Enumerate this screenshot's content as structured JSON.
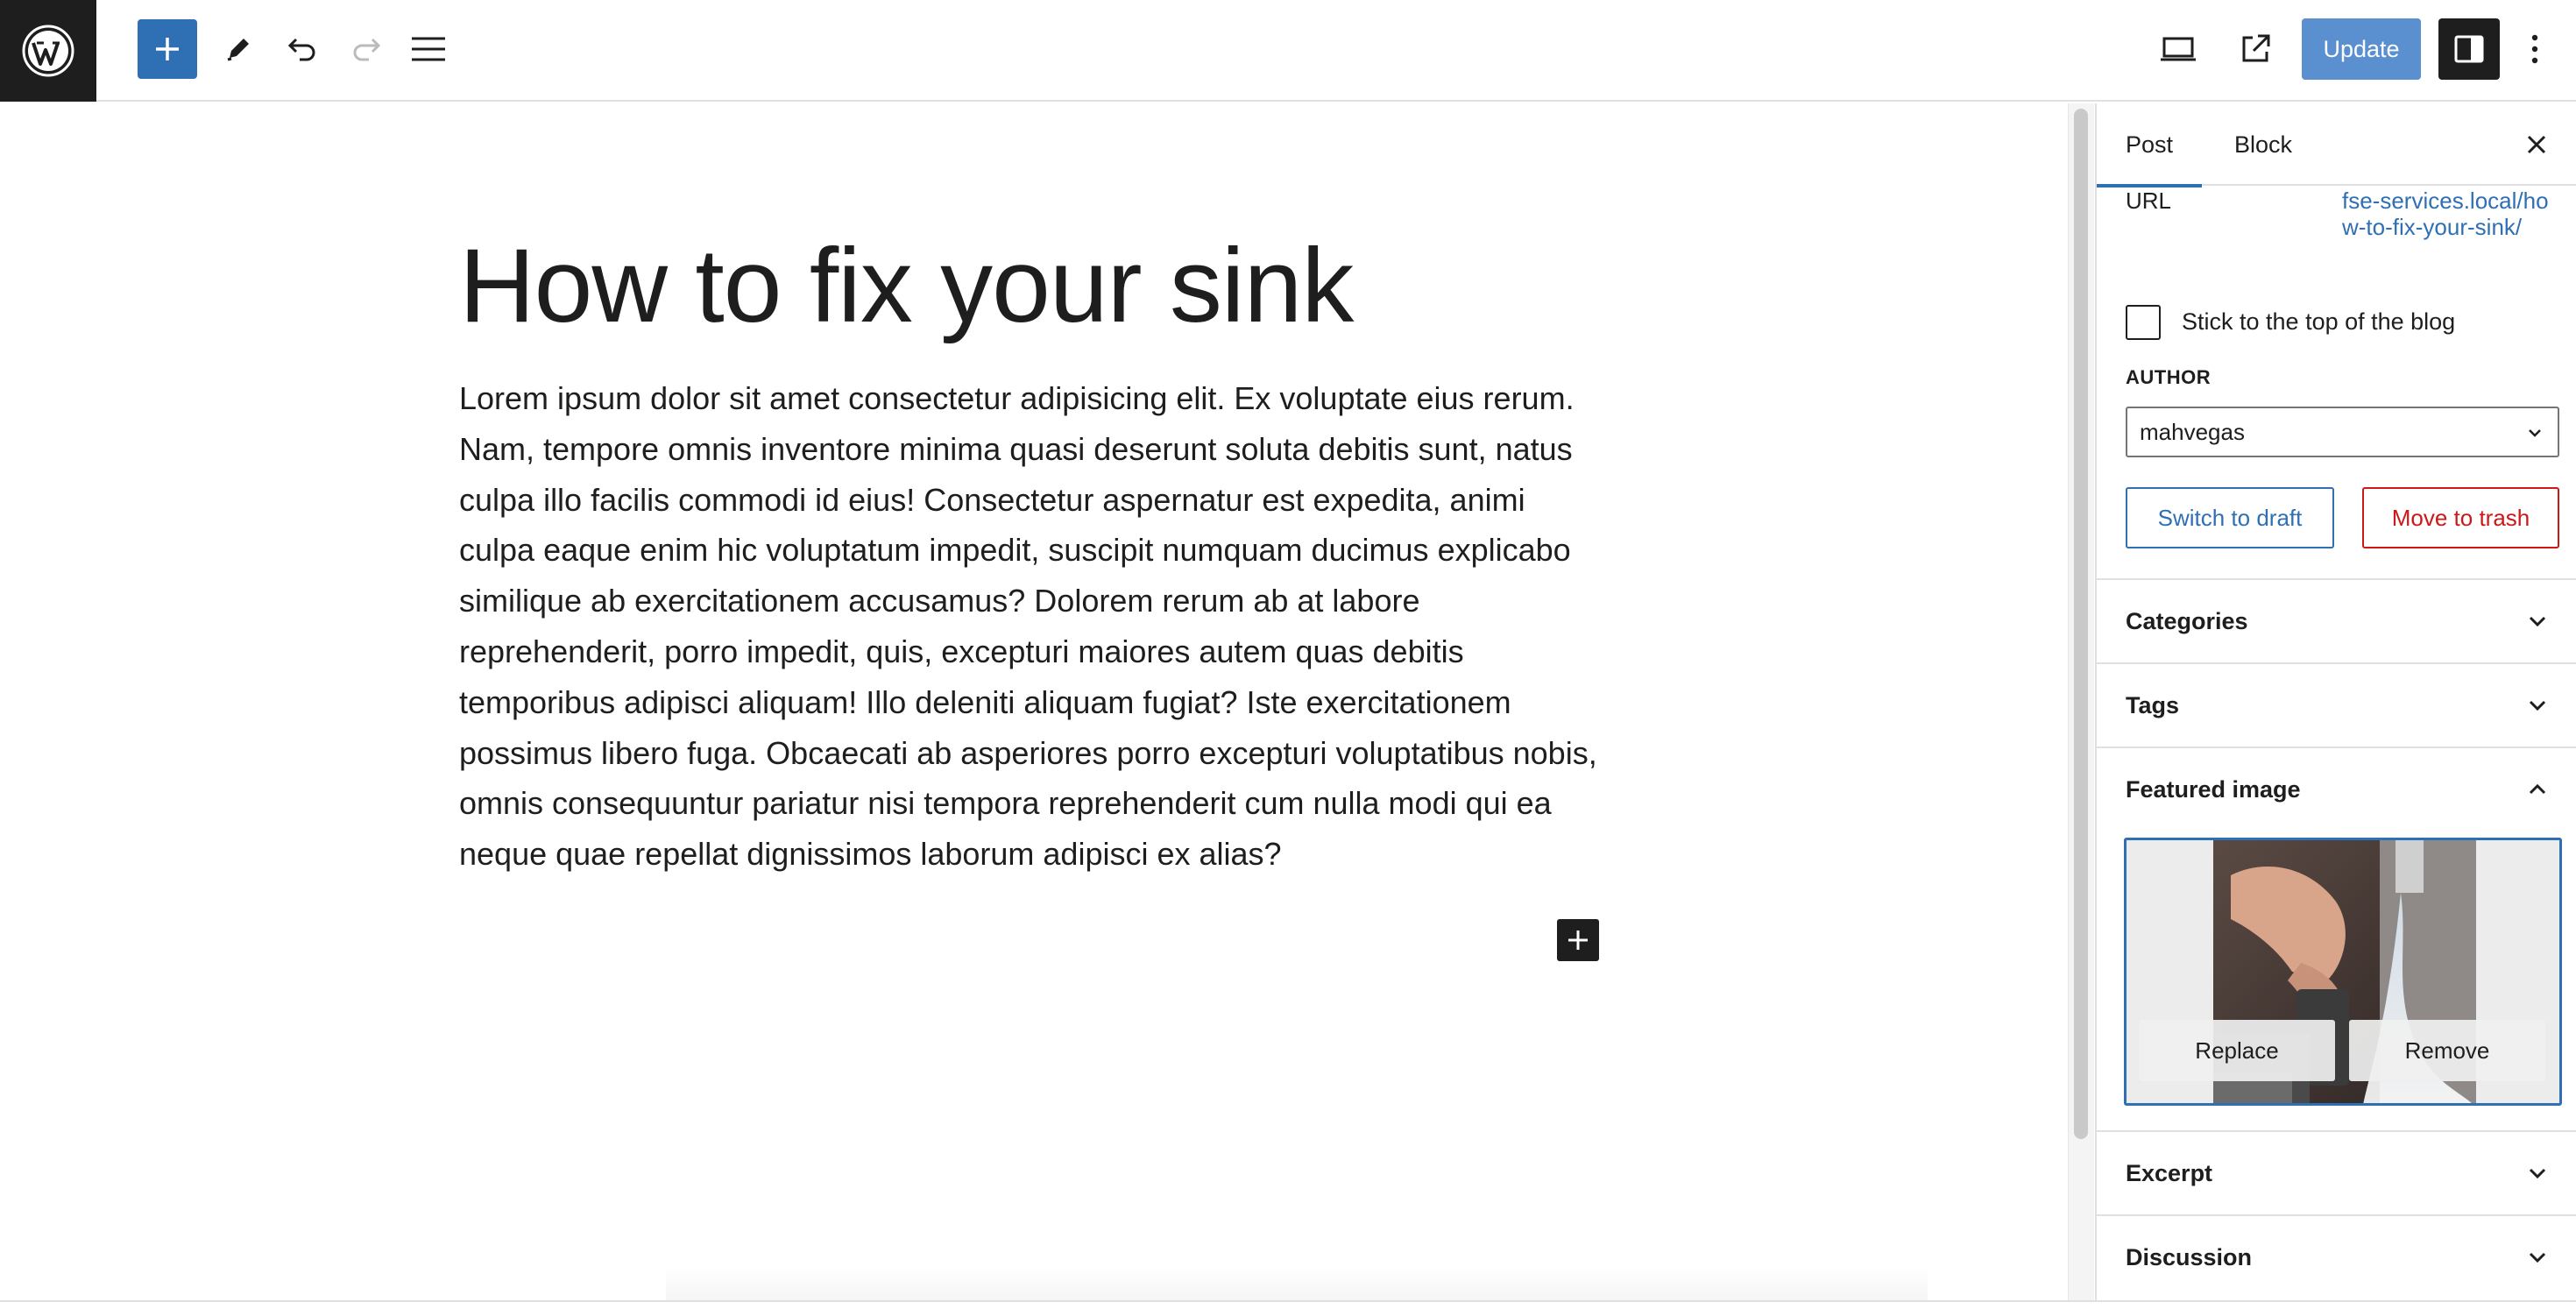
{
  "toolbar": {
    "update_label": "Update"
  },
  "post": {
    "title": "How to fix your sink",
    "body": "Lorem ipsum dolor sit amet consectetur adipisicing elit. Ex voluptate eius rerum. Nam, tempore omnis inventore minima quasi deserunt soluta debitis sunt, natus culpa illo facilis commodi id eius! Consectetur aspernatur est expedita, animi culpa eaque enim hic voluptatum impedit, suscipit numquam ducimus explicabo similique ab exercitationem accusamus? Dolorem rerum ab at labore reprehenderit, porro impedit, quis, excepturi maiores autem quas debitis temporibus adipisci aliquam! Illo deleniti aliquam fugiat? Iste exercitationem possimus libero fuga. Obcaecati ab asperiores porro excepturi voluptatibus nobis, omnis consequuntur pariatur nisi tempora reprehenderit cum nulla modi qui ea neque quae repellat dignissimos laborum adipisci ex alias?"
  },
  "sidebar": {
    "tabs": [
      {
        "label": "Post"
      },
      {
        "label": "Block"
      }
    ],
    "url_label": "URL",
    "url_value": "fse-services.local/how-to-fix-your-sink/",
    "sticky_label": "Stick to the top of the blog",
    "author_label": "AUTHOR",
    "author_value": "mahvegas",
    "switch_draft_label": "Switch to draft",
    "move_trash_label": "Move to trash",
    "panels": [
      {
        "title": "Categories"
      },
      {
        "title": "Tags"
      },
      {
        "title": "Featured image"
      },
      {
        "title": "Excerpt"
      },
      {
        "title": "Discussion"
      }
    ],
    "featured": {
      "replace_label": "Replace",
      "remove_label": "Remove"
    }
  },
  "colors": {
    "accent": "#2f6fb3",
    "danger": "#cc1818",
    "dark": "#1e1e1e"
  }
}
